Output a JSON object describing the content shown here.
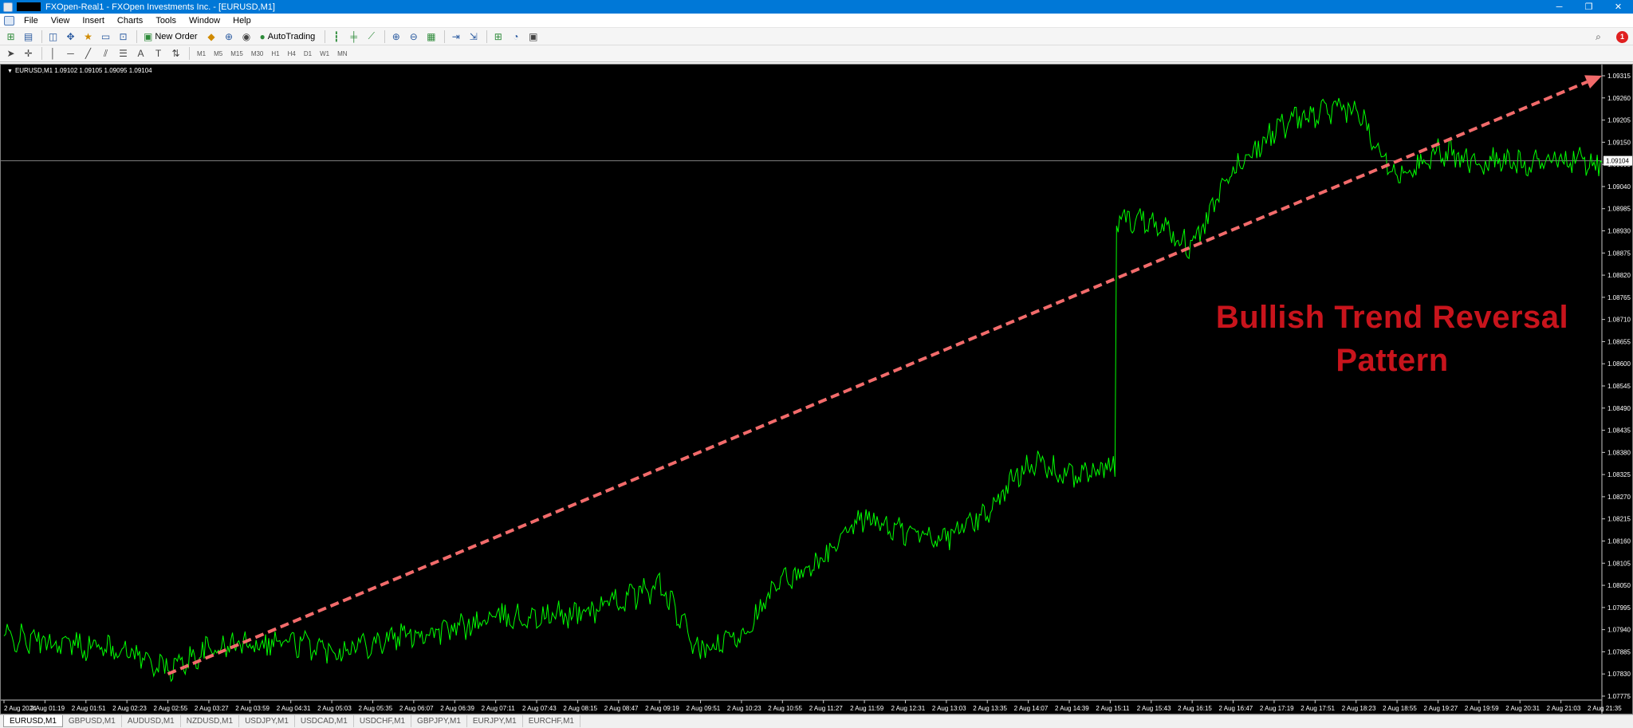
{
  "window": {
    "title": "FXOpen-Real1 - FXOpen Investments Inc. - [EURUSD,M1]",
    "controls": [
      "─",
      "❐",
      "✕"
    ]
  },
  "menu": [
    "File",
    "View",
    "Insert",
    "Charts",
    "Tools",
    "Window",
    "Help"
  ],
  "toolbar": {
    "new_order_label": "New Order",
    "autotrading_label": "AutoTrading",
    "timeframes": [
      "M1",
      "M5",
      "M15",
      "M30",
      "H1",
      "H4",
      "D1",
      "W1",
      "MN"
    ],
    "notification_count": "1"
  },
  "chart": {
    "info": "EURUSD,M1  1.09102 1.09105 1.09095 1.09104",
    "current_price": "1.09104",
    "line_color": "#00ff00",
    "trendline_color": "#f26b6b",
    "annotation_color": "#c8141c",
    "annotation_line1": "Bullish Trend Reversal",
    "annotation_line2": "Pattern"
  },
  "chart_data": {
    "type": "line",
    "symbol": "EURUSD",
    "timeframe": "M1",
    "price_axis": [
      "1.09315",
      "1.09260",
      "1.09205",
      "1.09150",
      "1.09095",
      "1.09040",
      "1.08985",
      "1.08930",
      "1.08875",
      "1.08820",
      "1.08765",
      "1.08710",
      "1.08655",
      "1.08600",
      "1.08545",
      "1.08490",
      "1.08435",
      "1.08380",
      "1.08325",
      "1.08270",
      "1.08215",
      "1.08160",
      "1.08105",
      "1.08050",
      "1.07995",
      "1.07940",
      "1.07885",
      "1.07830",
      "1.07775"
    ],
    "time_axis": [
      "2 Aug 2024",
      "2 Aug 01:19",
      "2 Aug 01:51",
      "2 Aug 02:23",
      "2 Aug 02:55",
      "2 Aug 03:27",
      "2 Aug 03:59",
      "2 Aug 04:31",
      "2 Aug 05:03",
      "2 Aug 05:35",
      "2 Aug 06:07",
      "2 Aug 06:39",
      "2 Aug 07:11",
      "2 Aug 07:43",
      "2 Aug 08:15",
      "2 Aug 08:47",
      "2 Aug 09:19",
      "2 Aug 09:51",
      "2 Aug 10:23",
      "2 Aug 10:55",
      "2 Aug 11:27",
      "2 Aug 11:59",
      "2 Aug 12:31",
      "2 Aug 13:03",
      "2 Aug 13:35",
      "2 Aug 14:07",
      "2 Aug 14:39",
      "2 Aug 15:11",
      "2 Aug 15:43",
      "2 Aug 16:15",
      "2 Aug 16:47",
      "2 Aug 17:19",
      "2 Aug 17:51",
      "2 Aug 18:23",
      "2 Aug 18:55",
      "2 Aug 19:27",
      "2 Aug 19:59",
      "2 Aug 20:31",
      "2 Aug 21:03",
      "2 Aug 21:35"
    ],
    "ylim": [
      1.07775,
      1.09315
    ],
    "series": [
      {
        "x": [
          "2 Aug 2024",
          "2 Aug 01:19",
          "2 Aug 01:51",
          "2 Aug 02:23",
          "2 Aug 02:55",
          "2 Aug 03:27",
          "2 Aug 03:59",
          "2 Aug 04:31",
          "2 Aug 05:03",
          "2 Aug 05:35",
          "2 Aug 06:07",
          "2 Aug 06:39",
          "2 Aug 07:11",
          "2 Aug 07:43",
          "2 Aug 08:15",
          "2 Aug 08:47",
          "2 Aug 09:19",
          "2 Aug 09:51",
          "2 Aug 10:23",
          "2 Aug 10:55",
          "2 Aug 11:27",
          "2 Aug 11:59",
          "2 Aug 12:31",
          "2 Aug 13:03",
          "2 Aug 13:35",
          "2 Aug 14:07",
          "2 Aug 14:39",
          "2 Aug 15:11",
          "2 Aug 15:43",
          "2 Aug 16:15",
          "2 Aug 16:47",
          "2 Aug 17:19",
          "2 Aug 17:51",
          "2 Aug 18:23",
          "2 Aug 18:55",
          "2 Aug 19:27",
          "2 Aug 19:59",
          "2 Aug 20:31",
          "2 Aug 21:03",
          "2 Aug 21:35"
        ],
        "values": [
          1.0792,
          1.0791,
          1.079,
          1.0789,
          1.0784,
          1.0789,
          1.0791,
          1.0791,
          1.0789,
          1.0791,
          1.0793,
          1.0794,
          1.0797,
          1.0797,
          1.0798,
          1.0801,
          1.0805,
          1.0788,
          1.0793,
          1.0806,
          1.0811,
          1.0822,
          1.0818,
          1.0817,
          1.0823,
          1.0836,
          1.0832,
          1.0834,
          1.0896,
          1.0889,
          1.0908,
          1.0918,
          1.0922,
          1.0923,
          1.0907,
          1.0913,
          1.091,
          1.091,
          1.0911,
          1.091
        ]
      }
    ],
    "trendline": {
      "from": [
        "2 Aug 02:55",
        1.0783
      ],
      "to": [
        "2 Aug 21:35",
        1.09315
      ],
      "style": "dashed-arrow"
    }
  },
  "tabs": [
    "EURUSD,M1",
    "GBPUSD,M1",
    "AUDUSD,M1",
    "NZDUSD,M1",
    "USDJPY,M1",
    "USDCAD,M1",
    "USDCHF,M1",
    "GBPJPY,M1",
    "EURJPY,M1",
    "EURCHF,M1"
  ]
}
